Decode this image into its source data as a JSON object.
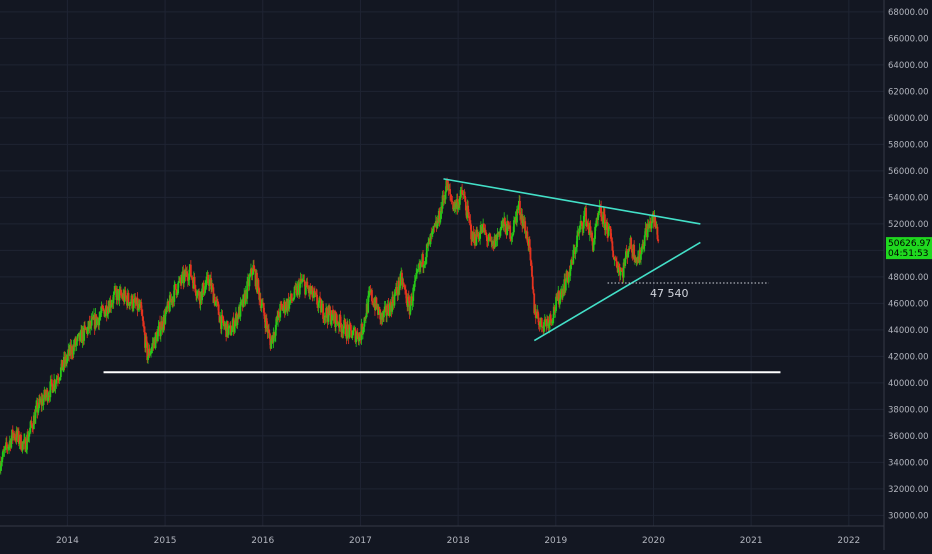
{
  "colors": {
    "background": "#131722",
    "grid": "#1f2433",
    "axis_text": "#b2b5be",
    "candle_up": "#28c819",
    "candle_down": "#e5331f",
    "trendline": "#43e0c8",
    "support": "#ffffff",
    "price_badge": "#1fd81f",
    "price_badge_text": "#000000"
  },
  "price_badge": {
    "price": "50626.97",
    "countdown": "04:51:53"
  },
  "annotation": {
    "label": "47 540"
  },
  "chart_data": {
    "type": "candlestick",
    "x_ticks": [
      "2014",
      "2015",
      "2016",
      "2017",
      "2018",
      "2019",
      "2020",
      "2021",
      "2022"
    ],
    "y_ticks": [
      "30000.00",
      "32000.00",
      "34000.00",
      "36000.00",
      "38000.00",
      "40000.00",
      "42000.00",
      "44000.00",
      "46000.00",
      "48000.00",
      "50000.00",
      "52000.00",
      "54000.00",
      "56000.00",
      "58000.00",
      "60000.00",
      "62000.00",
      "64000.00",
      "66000.00",
      "68000.00"
    ],
    "ylim": [
      29200,
      68900
    ],
    "xlim": [
      2013.31,
      2022.36
    ],
    "price_path": [
      [
        2013.31,
        34000
      ],
      [
        2013.45,
        36200
      ],
      [
        2013.56,
        35200
      ],
      [
        2013.7,
        38200
      ],
      [
        2013.82,
        39500
      ],
      [
        2013.92,
        40800
      ],
      [
        2014.05,
        42600
      ],
      [
        2014.2,
        44000
      ],
      [
        2014.35,
        45200
      ],
      [
        2014.5,
        46700
      ],
      [
        2014.65,
        46200
      ],
      [
        2014.75,
        45500
      ],
      [
        2014.82,
        42000
      ],
      [
        2014.9,
        43300
      ],
      [
        2015.0,
        45000
      ],
      [
        2015.1,
        47000
      ],
      [
        2015.25,
        48500
      ],
      [
        2015.35,
        46500
      ],
      [
        2015.45,
        47800
      ],
      [
        2015.58,
        44500
      ],
      [
        2015.66,
        43800
      ],
      [
        2015.8,
        46000
      ],
      [
        2015.9,
        48700
      ],
      [
        2016.0,
        45600
      ],
      [
        2016.08,
        43000
      ],
      [
        2016.18,
        45500
      ],
      [
        2016.3,
        46300
      ],
      [
        2016.4,
        47600
      ],
      [
        2016.52,
        46500
      ],
      [
        2016.62,
        45400
      ],
      [
        2016.75,
        44800
      ],
      [
        2016.88,
        43800
      ],
      [
        2017.0,
        43600
      ],
      [
        2017.1,
        46700
      ],
      [
        2017.22,
        44800
      ],
      [
        2017.32,
        46000
      ],
      [
        2017.42,
        47800
      ],
      [
        2017.5,
        45600
      ],
      [
        2017.6,
        48500
      ],
      [
        2017.7,
        50400
      ],
      [
        2017.8,
        52300
      ],
      [
        2017.88,
        54900
      ],
      [
        2017.96,
        53300
      ],
      [
        2018.05,
        54300
      ],
      [
        2018.15,
        50800
      ],
      [
        2018.25,
        51600
      ],
      [
        2018.35,
        50200
      ],
      [
        2018.45,
        52000
      ],
      [
        2018.55,
        51300
      ],
      [
        2018.62,
        53400
      ],
      [
        2018.72,
        50700
      ],
      [
        2018.78,
        45600
      ],
      [
        2018.85,
        44400
      ],
      [
        2018.95,
        44900
      ],
      [
        2019.05,
        46800
      ],
      [
        2019.15,
        48500
      ],
      [
        2019.22,
        51000
      ],
      [
        2019.3,
        52700
      ],
      [
        2019.38,
        50500
      ],
      [
        2019.45,
        52900
      ],
      [
        2019.55,
        51300
      ],
      [
        2019.6,
        49400
      ],
      [
        2019.68,
        48300
      ],
      [
        2019.75,
        50500
      ],
      [
        2019.85,
        49300
      ],
      [
        2019.92,
        51400
      ],
      [
        2020.0,
        52400
      ],
      [
        2020.05,
        51000
      ]
    ],
    "trendlines": [
      {
        "role": "upper-resistance",
        "from": [
          2017.85,
          55400
        ],
        "to": [
          2020.48,
          52000
        ]
      },
      {
        "role": "lower-support",
        "from": [
          2018.78,
          43200
        ],
        "to": [
          2020.48,
          50600
        ]
      },
      {
        "role": "horizontal-support",
        "from": [
          2014.37,
          40800
        ],
        "to": [
          2021.3,
          40800
        ]
      },
      {
        "role": "dotted-level",
        "from": [
          2019.53,
          47540
        ],
        "to": [
          2021.18,
          47540
        ]
      }
    ]
  }
}
